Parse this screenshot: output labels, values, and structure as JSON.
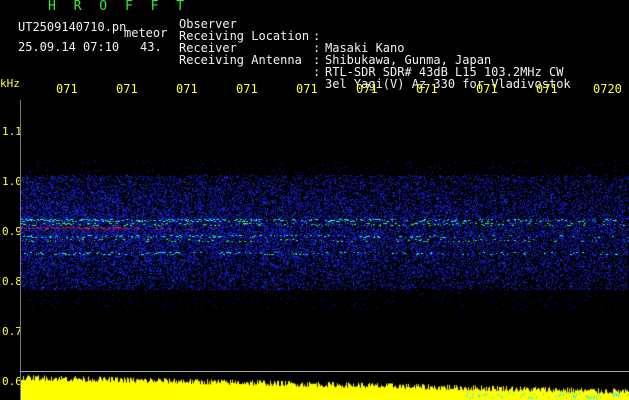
{
  "header": {
    "title": "H R O F F T",
    "filename": "UT2509140710.pn",
    "meteor_label": "meteor",
    "datetime": "25.09.14 07:10",
    "count": "43."
  },
  "info": [
    {
      "label": "Observer",
      "value": "Masaki Kano"
    },
    {
      "label": "Receiving Location",
      "value": "Shibukawa, Gunma, Japan"
    },
    {
      "label": "Receiver",
      "value": "RTL-SDR SDR# 43dB L15 103.2MHz CW"
    },
    {
      "label": "Receiving Antenna",
      "value": "3el Yagi(V) Az 330 for Vladivostok"
    }
  ],
  "colon": ":",
  "freq_axis": {
    "unit": "kHz",
    "ticks": [
      "1.1",
      "1.0",
      "0.9",
      "0.8",
      "0.7",
      "0.6"
    ]
  },
  "time_axis": {
    "ticks": [
      "071",
      "071",
      "071",
      "071",
      "071",
      "071",
      "071",
      "071",
      "071",
      "0720"
    ]
  },
  "colors": {
    "background": "#000000",
    "text_green": "#33ee33",
    "text_yellow": "#ffff33",
    "text_white": "#f2f2f2",
    "noise_blue": "#1a2fff",
    "signal_cyan": "#00ffff",
    "signal_green": "#33ff33",
    "signal_red": "#ff2020",
    "power_bar": "#ffff00"
  }
}
